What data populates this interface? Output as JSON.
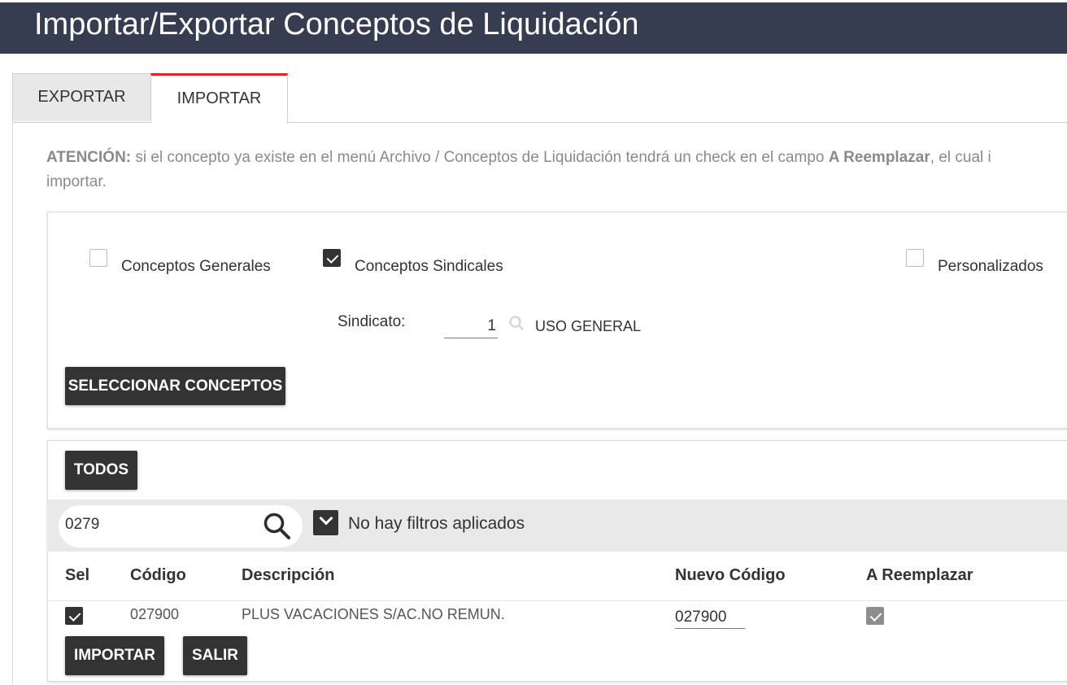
{
  "page": {
    "title": "Importar/Exportar Conceptos de Liquidación"
  },
  "tabs": [
    {
      "label": "EXPORTAR",
      "active": false
    },
    {
      "label": "IMPORTAR",
      "active": true
    }
  ],
  "notice": {
    "bold1": "ATENCIÓN:",
    "text1": " si el concepto ya existe en el menú Archivo / Conceptos de Liquidación tendrá un check en el campo ",
    "bold2": "A Reemplazar",
    "text2": ", el cual i",
    "line2": "importar."
  },
  "options": {
    "generales": {
      "label": "Conceptos Generales",
      "checked": false
    },
    "sindicales": {
      "label": "Conceptos Sindicales",
      "checked": true
    },
    "personalizados": {
      "label": "Personalizados",
      "checked": false
    }
  },
  "sindicato": {
    "label": "Sindicato:",
    "value": "1",
    "name": "USO GENERAL",
    "icon": "search-icon"
  },
  "buttons": {
    "seleccionar": "SELECCIONAR CONCEPTOS",
    "todos": "TODOS",
    "importar": "IMPORTAR",
    "salir": "SALIR"
  },
  "filter": {
    "search_value": "0279",
    "status": "No hay filtros aplicados",
    "icon": "search-icon"
  },
  "table": {
    "headers": {
      "sel": "Sel",
      "codigo": "Código",
      "descripcion": "Descripción",
      "nuevo": "Nuevo Código",
      "reemplazar": "A Reemplazar"
    },
    "rows": [
      {
        "sel": true,
        "codigo": "027900",
        "descripcion": "PLUS VACACIONES S/AC.NO REMUN.",
        "nuevo_codigo": "027900",
        "a_reemplazar": true
      }
    ]
  },
  "colors": {
    "header_bg": "#373d50",
    "active_tab_accent": "#e3232c",
    "button_bg": "#333333"
  }
}
